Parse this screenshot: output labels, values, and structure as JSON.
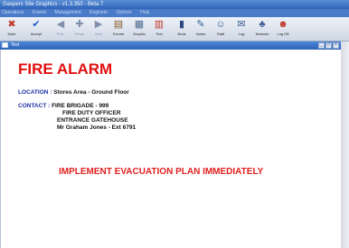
{
  "window": {
    "title": "Gaspers Site Graphics - v1.3.350 - Beta 7"
  },
  "menu": [
    {
      "label": "Operations"
    },
    {
      "label": "Events"
    },
    {
      "label": "Management"
    },
    {
      "label": "Engineer"
    },
    {
      "label": "Options"
    },
    {
      "label": "Help"
    }
  ],
  "toolbar": [
    {
      "label": "Mute",
      "icon": "mute-icon",
      "glyph": "✖",
      "color": "#c0392b",
      "enabled": true
    },
    {
      "label": "Accept",
      "icon": "accept-icon",
      "glyph": "✔",
      "color": "#1f5fd1",
      "enabled": true
    },
    {
      "label": "Prev",
      "icon": "arrow-left-icon",
      "glyph": "◀",
      "color": "#7f8fa8",
      "enabled": false
    },
    {
      "label": "Reset",
      "icon": "reset-icon",
      "glyph": "✚",
      "color": "#7f8fa8",
      "enabled": false
    },
    {
      "label": "Next",
      "icon": "arrow-right-icon",
      "glyph": "▶",
      "color": "#7f8fa8",
      "enabled": false
    },
    {
      "label": "Events",
      "icon": "events-icon",
      "glyph": "▤",
      "color": "#8b5a2b",
      "enabled": true
    },
    {
      "label": "Graphic",
      "icon": "graphic-icon",
      "glyph": "▦",
      "color": "#4c6a8f",
      "enabled": true
    },
    {
      "label": "Text",
      "icon": "text-icon",
      "glyph": "▥",
      "color": "#c0392b",
      "enabled": true
    },
    {
      "label": "Book",
      "icon": "book-icon",
      "glyph": "▮",
      "color": "#2e4a82",
      "enabled": true
    },
    {
      "label": "Notes",
      "icon": "notes-icon",
      "glyph": "✎",
      "color": "#3b5b8f",
      "enabled": true
    },
    {
      "label": "Staff",
      "icon": "staff-icon",
      "glyph": "☺",
      "color": "#3b5b8f",
      "enabled": true
    },
    {
      "label": "Log",
      "icon": "log-icon",
      "glyph": "✉",
      "color": "#3b5b8f",
      "enabled": true
    },
    {
      "label": "Network",
      "icon": "network-icon",
      "glyph": "♣",
      "color": "#3b5b8f",
      "enabled": true
    },
    {
      "label": "Log Off",
      "icon": "log-off-icon",
      "glyph": "☻",
      "color": "#c0392b",
      "enabled": true
    }
  ],
  "panel": {
    "title": "Text"
  },
  "alert": {
    "heading": "FIRE ALARM",
    "location_label": "LOCATION :",
    "location_value": "Stores Area - Ground Floor",
    "contact_label": "CONTACT  :",
    "contact_lines": [
      "FIRE BRIGADE - 999",
      "FIRE DUTY OFFICER",
      "ENTRANCE GATEHOUSE",
      "Mr Graham Jones - Ext 6791"
    ],
    "instruction": "IMPLEMENT EVACUATION PLAN IMMEDIATELY"
  }
}
